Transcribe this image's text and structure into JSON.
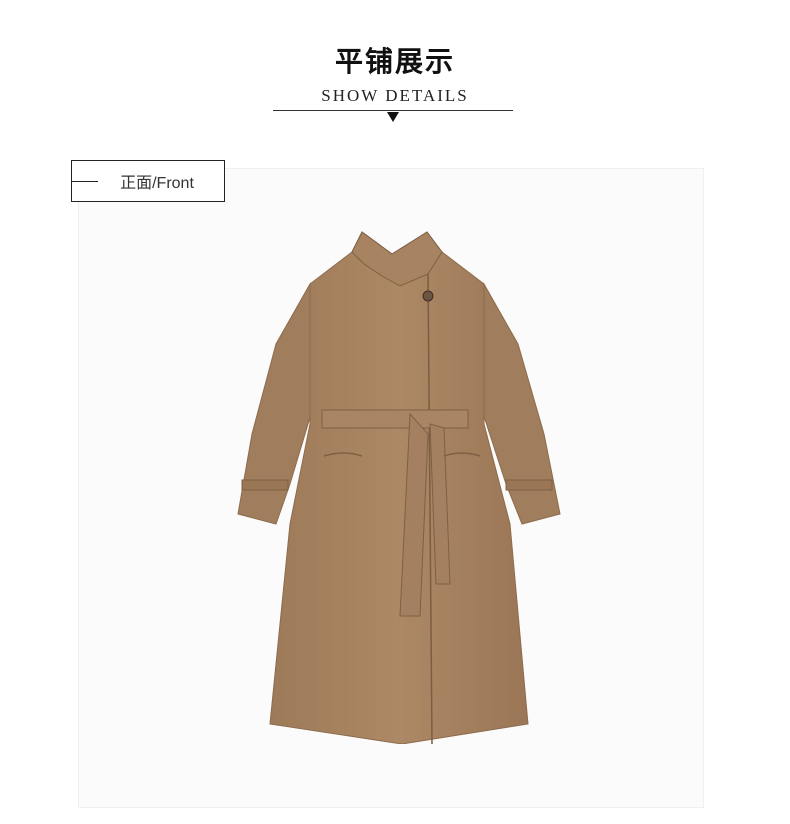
{
  "header": {
    "title_cn": "平铺展示",
    "title_en": "SHOW DETAILS"
  },
  "label": {
    "text": "正面/Front"
  },
  "product": {
    "image_alt": "camel trench coat with belt",
    "color": "#a88463"
  },
  "icons": {
    "arrow": "triangle-down-icon"
  }
}
